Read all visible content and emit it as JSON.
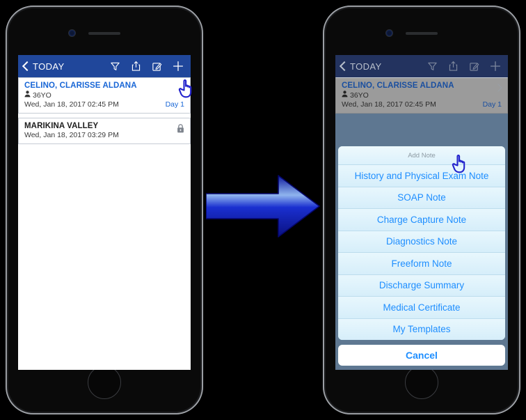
{
  "app": {
    "nav": {
      "back_label": "TODAY",
      "icons": [
        {
          "name": "filter-icon",
          "label": "Filter"
        },
        {
          "name": "share-icon",
          "label": "Share"
        },
        {
          "name": "compose-icon",
          "label": "Compose"
        },
        {
          "name": "plus-icon",
          "label": "Add"
        }
      ]
    },
    "colors": {
      "navbar": "#20479b",
      "navbar_dimmed": "#23335f",
      "link_blue": "#1866d6",
      "sheet_blue": "#1e8eff",
      "arrow_blue": "#1a1ad0",
      "cursor_blue": "#2222cc",
      "dim_body": "#5e7791"
    }
  },
  "left_phone": {
    "list": [
      {
        "name": "CELINO, CLARISSE  ALDANA",
        "age": "36YO",
        "datetime": "Wed, Jan 18, 2017 02:45 PM",
        "day_badge": "Day 1",
        "title_style": "link",
        "accessory": "none"
      },
      {
        "name": "MARIKINA VALLEY",
        "age": "",
        "datetime": "Wed, Jan 18, 2017 03:29 PM",
        "day_badge": "",
        "title_style": "dark",
        "accessory": "lock-icon"
      }
    ]
  },
  "right_phone": {
    "list": [
      {
        "name": "CELINO, CLARISSE  ALDANA",
        "age": "36YO",
        "datetime": "Wed, Jan 18, 2017 02:45 PM",
        "day_badge": "Day 1",
        "title_style": "link",
        "accessory": "chevron"
      }
    ],
    "action_sheet": {
      "header": "Add Note",
      "options": [
        "History and Physical Exam Note",
        "SOAP Note",
        "Charge Capture Note",
        "Diagnostics Note",
        "Freeform Note",
        "Discharge Summary",
        "Medical Certificate",
        "My Templates"
      ],
      "cancel_label": "Cancel"
    }
  },
  "transition": {
    "arrow_name": "right-arrow",
    "cursor_left_target": "plus-icon",
    "cursor_right_target": "SOAP Note"
  }
}
